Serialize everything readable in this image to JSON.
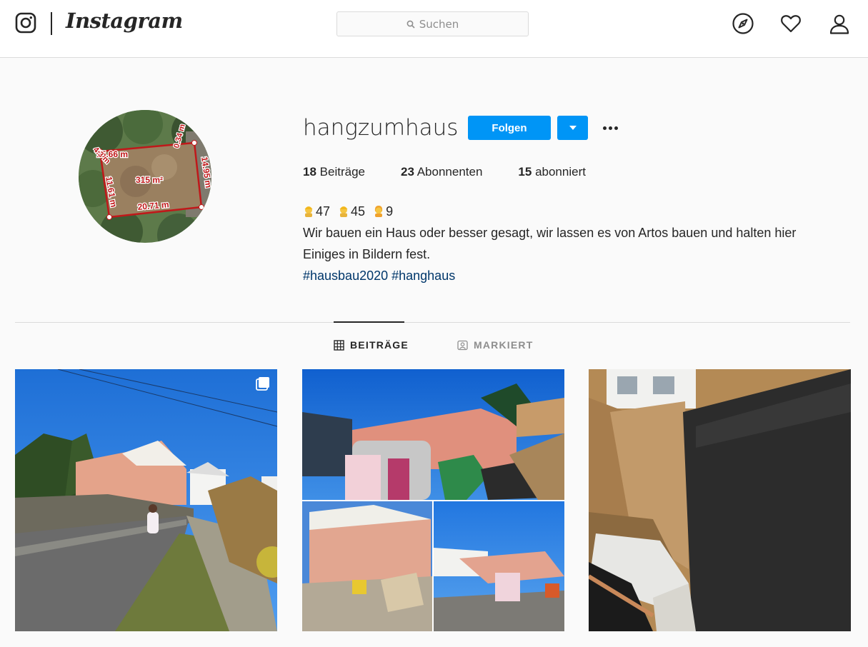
{
  "header": {
    "brand": "Instagram",
    "search": {
      "placeholder": "Suchen"
    },
    "icons": [
      "instagram-glyph-icon",
      "explore-compass-icon",
      "heart-icon",
      "profile-icon"
    ]
  },
  "profile": {
    "username": "hangzumhaus",
    "follow_label": "Folgen",
    "avatar_labels": {
      "area": "315 m²",
      "top": "15.66 m",
      "bottom": "20.71 m",
      "left": "11.61 m",
      "right": "14.95 m",
      "corner": "0.34 m",
      "edge": "4.3 m"
    },
    "stats": [
      {
        "count": "18",
        "label": "Beiträge"
      },
      {
        "count": "23",
        "label": "Abonnenten"
      },
      {
        "count": "15",
        "label": "abonniert"
      }
    ],
    "bio": {
      "emoji_counts": [
        "47",
        "45",
        "9"
      ],
      "text_line_1": "Wir bauen ein Haus oder besser gesagt, wir lassen es von Artos bauen und halten hier",
      "text_line_2": "Einiges in Bildern fest.",
      "hashtags": "#hausbau2020 #hanghaus"
    }
  },
  "tabs": [
    {
      "label": "BEITRÄGE",
      "active": true,
      "icon": "grid-icon"
    },
    {
      "label": "MARKIERT",
      "active": false,
      "icon": "tagged-person-icon"
    }
  ],
  "posts": [
    {
      "kind": "carousel",
      "scene": "road-with-new-house"
    },
    {
      "kind": "image",
      "scene": "construction-collage"
    },
    {
      "kind": "image",
      "scene": "concrete-wall-excavation"
    }
  ],
  "colors": {
    "accent": "#0095f6",
    "hashtag": "#00376b",
    "text": "#262626",
    "muted": "#8e8e8e"
  }
}
